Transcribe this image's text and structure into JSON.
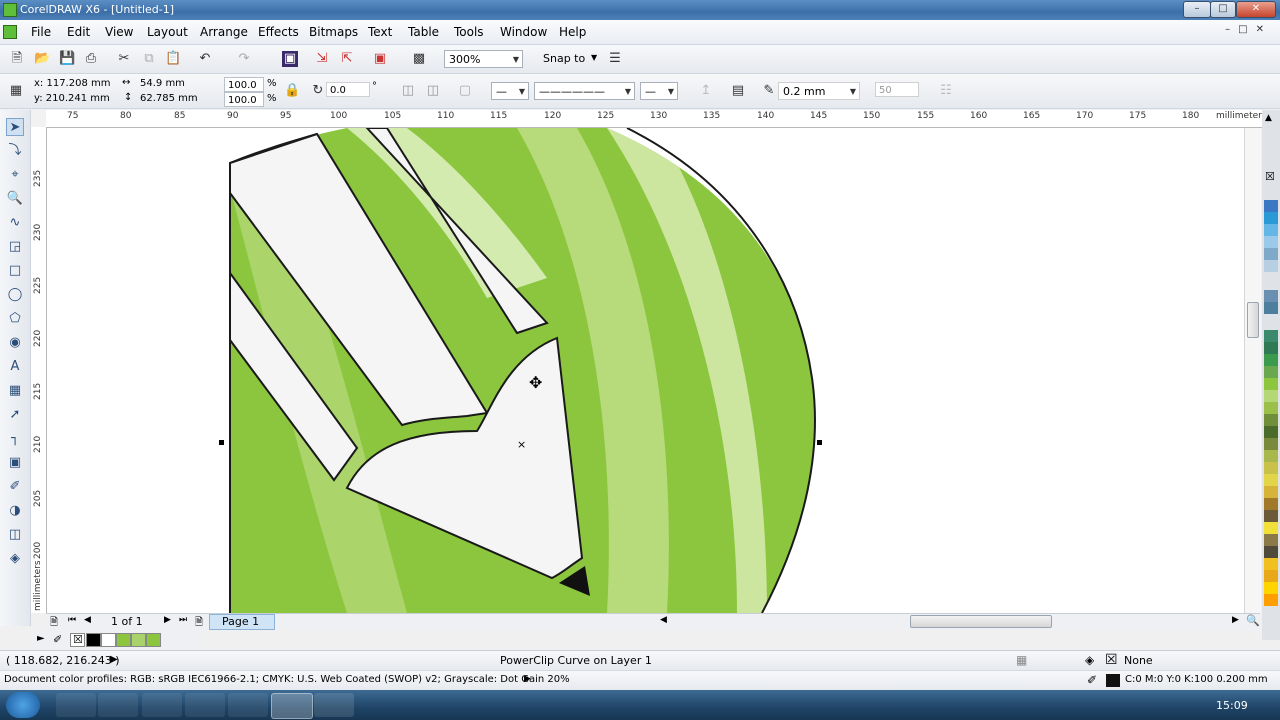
{
  "window": {
    "title": "CorelDRAW X6 - [Untitled-1]"
  },
  "menu": [
    "File",
    "Edit",
    "View",
    "Layout",
    "Arrange",
    "Effects",
    "Bitmaps",
    "Text",
    "Table",
    "Tools",
    "Window",
    "Help"
  ],
  "toolbar": {
    "zoom_value": "300%",
    "snap_label": "Snap to"
  },
  "property_bar": {
    "x": "x: 117.208 mm",
    "y": "y: 210.241 mm",
    "width": "54.9 mm",
    "height": "62.785 mm",
    "scale_x": "100.0",
    "scale_y": "100.0",
    "percent": "%",
    "rotation": "0.0",
    "degree": "°",
    "outline_width": "0.2 mm",
    "miter": "50"
  },
  "ruler": {
    "h_labels": [
      "75",
      "80",
      "85",
      "90",
      "95",
      "100",
      "105",
      "110",
      "115",
      "120",
      "125",
      "130",
      "135",
      "140",
      "145",
      "150",
      "155",
      "160",
      "165",
      "170",
      "175",
      "180"
    ],
    "units": "millimeters",
    "v_labels": [
      "235",
      "230",
      "225",
      "220",
      "215",
      "210",
      "205",
      "200"
    ]
  },
  "pager": {
    "count": "1 of 1",
    "tab": "Page 1"
  },
  "status": {
    "coords": "( 118.682, 216.243 )",
    "object": "PowerClip Curve on Layer 1",
    "fill_label": "None",
    "profiles": "Document color profiles: RGB: sRGB IEC61966-2.1; CMYK: U.S. Web Coated (SWOP) v2; Grayscale: Dot Gain 20%",
    "outline_info": "C:0 M:0 Y:0 K:100  0.200 mm"
  },
  "taskbar": {
    "clock": "15:09"
  },
  "colors": {
    "green_dark": "#8cc63f",
    "green_mid": "#a8d26a",
    "green_light": "#cde69f",
    "outline": "#1a1a1a"
  }
}
